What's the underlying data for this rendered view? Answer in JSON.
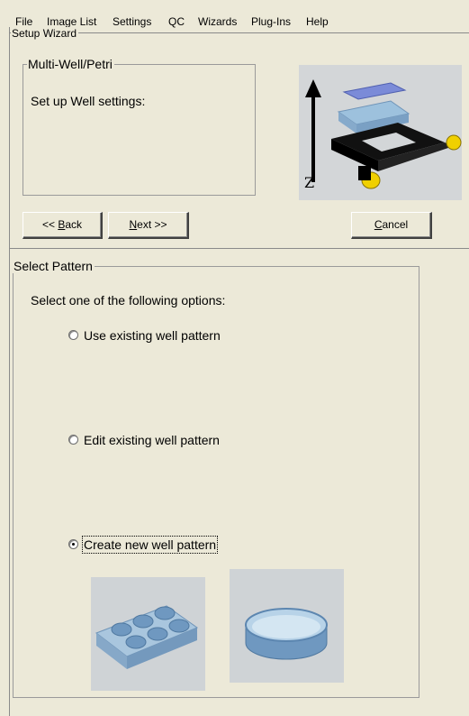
{
  "menu": [
    "File",
    "Image List",
    "Settings",
    "QC",
    "Wizards",
    "Plug-Ins",
    "Help"
  ],
  "wizard": {
    "title": "Setup Wizard",
    "step_group_title": "Multi-Well/Petri",
    "step_description": "Set up Well settings:",
    "buttons": {
      "back_prefix": "<< ",
      "back_hotkey": "B",
      "back_rest": "ack",
      "next_hotkey": "N",
      "next_rest": "ext >>",
      "cancel_hotkey": "C",
      "cancel_rest": "ancel"
    },
    "illustration_icon": "stage-z-axis-illustration",
    "axis_letter": "Z"
  },
  "select_pattern": {
    "title": "Select Pattern",
    "prompt": "Select one of the following options:",
    "options": [
      {
        "label": "Use existing well pattern",
        "selected": false
      },
      {
        "label": "Edit existing well pattern",
        "selected": false
      },
      {
        "label": "Create new well pattern",
        "selected": true
      }
    ],
    "images": [
      "multi-well-plate-image",
      "petri-dish-image"
    ]
  },
  "colors": {
    "background": "#ece9d8",
    "illustration_bg": "#d3d6d8",
    "plastic_blue": "#8fb1d4",
    "accent_yellow": "#f0d000"
  }
}
